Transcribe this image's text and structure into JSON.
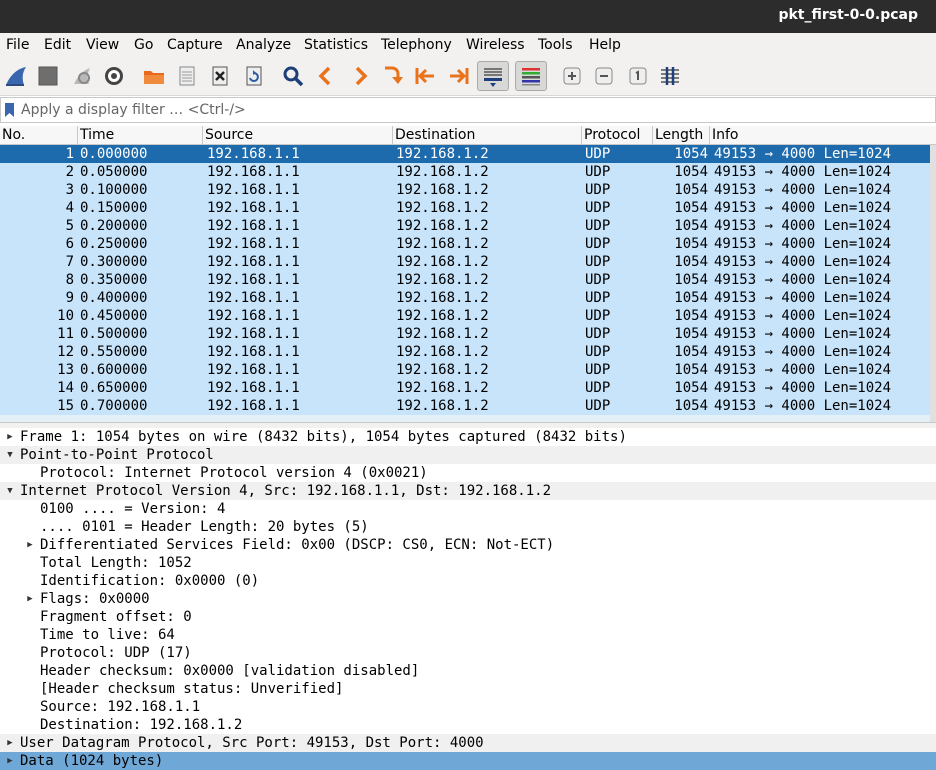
{
  "window": {
    "title": "pkt_first-0-0.pcap"
  },
  "menu": [
    "File",
    "Edit",
    "View",
    "Go",
    "Capture",
    "Analyze",
    "Statistics",
    "Telephony",
    "Wireless",
    "Tools",
    "Help"
  ],
  "toolbar": {
    "icons": [
      "shark-fin-icon",
      "stop-icon",
      "restart-icon",
      "gear-icon",
      "open-folder-icon",
      "file-icon",
      "close-file-icon",
      "reload-icon",
      "search-icon",
      "prev-icon",
      "next-icon",
      "go-to-icon",
      "first-icon",
      "last-icon",
      "autoscroll-icon",
      "colorize-icon",
      "zoom-in-icon",
      "zoom-out-icon",
      "zoom-normal-icon",
      "resize-columns-icon"
    ]
  },
  "filter": {
    "placeholder": "Apply a display filter … <Ctrl-/>"
  },
  "packet_list": {
    "columns": [
      "No.",
      "Time",
      "Source",
      "Destination",
      "Protocol",
      "Length",
      "Info"
    ],
    "rows": [
      {
        "no": "1",
        "time": "0.000000",
        "src": "192.168.1.1",
        "dst": "192.168.1.2",
        "proto": "UDP",
        "len": "1054",
        "info": "49153 → 4000 Len=1024"
      },
      {
        "no": "2",
        "time": "0.050000",
        "src": "192.168.1.1",
        "dst": "192.168.1.2",
        "proto": "UDP",
        "len": "1054",
        "info": "49153 → 4000 Len=1024"
      },
      {
        "no": "3",
        "time": "0.100000",
        "src": "192.168.1.1",
        "dst": "192.168.1.2",
        "proto": "UDP",
        "len": "1054",
        "info": "49153 → 4000 Len=1024"
      },
      {
        "no": "4",
        "time": "0.150000",
        "src": "192.168.1.1",
        "dst": "192.168.1.2",
        "proto": "UDP",
        "len": "1054",
        "info": "49153 → 4000 Len=1024"
      },
      {
        "no": "5",
        "time": "0.200000",
        "src": "192.168.1.1",
        "dst": "192.168.1.2",
        "proto": "UDP",
        "len": "1054",
        "info": "49153 → 4000 Len=1024"
      },
      {
        "no": "6",
        "time": "0.250000",
        "src": "192.168.1.1",
        "dst": "192.168.1.2",
        "proto": "UDP",
        "len": "1054",
        "info": "49153 → 4000 Len=1024"
      },
      {
        "no": "7",
        "time": "0.300000",
        "src": "192.168.1.1",
        "dst": "192.168.1.2",
        "proto": "UDP",
        "len": "1054",
        "info": "49153 → 4000 Len=1024"
      },
      {
        "no": "8",
        "time": "0.350000",
        "src": "192.168.1.1",
        "dst": "192.168.1.2",
        "proto": "UDP",
        "len": "1054",
        "info": "49153 → 4000 Len=1024"
      },
      {
        "no": "9",
        "time": "0.400000",
        "src": "192.168.1.1",
        "dst": "192.168.1.2",
        "proto": "UDP",
        "len": "1054",
        "info": "49153 → 4000 Len=1024"
      },
      {
        "no": "10",
        "time": "0.450000",
        "src": "192.168.1.1",
        "dst": "192.168.1.2",
        "proto": "UDP",
        "len": "1054",
        "info": "49153 → 4000 Len=1024"
      },
      {
        "no": "11",
        "time": "0.500000",
        "src": "192.168.1.1",
        "dst": "192.168.1.2",
        "proto": "UDP",
        "len": "1054",
        "info": "49153 → 4000 Len=1024"
      },
      {
        "no": "12",
        "time": "0.550000",
        "src": "192.168.1.1",
        "dst": "192.168.1.2",
        "proto": "UDP",
        "len": "1054",
        "info": "49153 → 4000 Len=1024"
      },
      {
        "no": "13",
        "time": "0.600000",
        "src": "192.168.1.1",
        "dst": "192.168.1.2",
        "proto": "UDP",
        "len": "1054",
        "info": "49153 → 4000 Len=1024"
      },
      {
        "no": "14",
        "time": "0.650000",
        "src": "192.168.1.1",
        "dst": "192.168.1.2",
        "proto": "UDP",
        "len": "1054",
        "info": "49153 → 4000 Len=1024"
      },
      {
        "no": "15",
        "time": "0.700000",
        "src": "192.168.1.1",
        "dst": "192.168.1.2",
        "proto": "UDP",
        "len": "1054",
        "info": "49153 → 4000 Len=1024"
      }
    ]
  },
  "details": [
    {
      "indent": 0,
      "arrow": "collapsed",
      "text": "Frame 1: 1054 bytes on wire (8432 bits), 1054 bytes captured (8432 bits)",
      "style": "normal"
    },
    {
      "indent": 0,
      "arrow": "expanded",
      "text": "Point-to-Point Protocol",
      "style": "header"
    },
    {
      "indent": 1,
      "arrow": "none",
      "text": "Protocol: Internet Protocol version 4 (0x0021)",
      "style": "normal"
    },
    {
      "indent": 0,
      "arrow": "expanded",
      "text": "Internet Protocol Version 4, Src: 192.168.1.1, Dst: 192.168.1.2",
      "style": "header"
    },
    {
      "indent": 1,
      "arrow": "none",
      "text": "0100 .... = Version: 4",
      "style": "normal"
    },
    {
      "indent": 1,
      "arrow": "none",
      "text": ".... 0101 = Header Length: 20 bytes (5)",
      "style": "normal"
    },
    {
      "indent": 1,
      "arrow": "collapsed",
      "text": "Differentiated Services Field: 0x00 (DSCP: CS0, ECN: Not-ECT)",
      "style": "normal"
    },
    {
      "indent": 1,
      "arrow": "none",
      "text": "Total Length: 1052",
      "style": "normal"
    },
    {
      "indent": 1,
      "arrow": "none",
      "text": "Identification: 0x0000 (0)",
      "style": "normal"
    },
    {
      "indent": 1,
      "arrow": "collapsed",
      "text": "Flags: 0x0000",
      "style": "normal"
    },
    {
      "indent": 1,
      "arrow": "none",
      "text": "Fragment offset: 0",
      "style": "normal"
    },
    {
      "indent": 1,
      "arrow": "none",
      "text": "Time to live: 64",
      "style": "normal"
    },
    {
      "indent": 1,
      "arrow": "none",
      "text": "Protocol: UDP (17)",
      "style": "normal"
    },
    {
      "indent": 1,
      "arrow": "none",
      "text": "Header checksum: 0x0000 [validation disabled]",
      "style": "normal"
    },
    {
      "indent": 1,
      "arrow": "none",
      "text": "[Header checksum status: Unverified]",
      "style": "normal"
    },
    {
      "indent": 1,
      "arrow": "none",
      "text": "Source: 192.168.1.1",
      "style": "normal"
    },
    {
      "indent": 1,
      "arrow": "none",
      "text": "Destination: 192.168.1.2",
      "style": "normal"
    },
    {
      "indent": 0,
      "arrow": "collapsed",
      "text": "User Datagram Protocol, Src Port: 49153, Dst Port: 4000",
      "style": "header"
    },
    {
      "indent": 0,
      "arrow": "collapsed",
      "text": "Data (1024 bytes)",
      "style": "selected"
    }
  ]
}
